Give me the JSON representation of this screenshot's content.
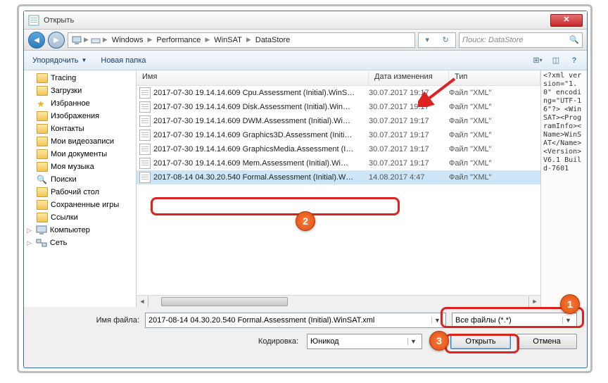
{
  "title": "Открыть",
  "close_glyph": "✕",
  "breadcrumb": [
    "Windows",
    "Performance",
    "WinSAT",
    "DataStore"
  ],
  "search_placeholder": "Поиск: DataStore",
  "toolbar": {
    "organize": "Упорядочить",
    "new_folder": "Новая папка"
  },
  "tree": {
    "items": [
      {
        "label": "Tracing",
        "icon": "folder",
        "lvl": 1
      },
      {
        "label": "Загрузки",
        "icon": "folder",
        "lvl": 1
      },
      {
        "label": "Избранное",
        "icon": "star",
        "lvl": 1
      },
      {
        "label": "Изображения",
        "icon": "image",
        "lvl": 1
      },
      {
        "label": "Контакты",
        "icon": "contact",
        "lvl": 1
      },
      {
        "label": "Мои видеозаписи",
        "icon": "video",
        "lvl": 1
      },
      {
        "label": "Мои документы",
        "icon": "doc",
        "lvl": 1
      },
      {
        "label": "Моя музыка",
        "icon": "music",
        "lvl": 1
      },
      {
        "label": "Поиски",
        "icon": "search",
        "lvl": 1
      },
      {
        "label": "Рабочий стол",
        "icon": "desktop",
        "lvl": 1
      },
      {
        "label": "Сохраненные игры",
        "icon": "games",
        "lvl": 1
      },
      {
        "label": "Ссылки",
        "icon": "link",
        "lvl": 1
      },
      {
        "label": "Компьютер",
        "icon": "computer",
        "lvl": 0
      },
      {
        "label": "Сеть",
        "icon": "network",
        "lvl": 0
      }
    ]
  },
  "columns": {
    "name": "Имя",
    "date": "Дата изменения",
    "type": "Тип"
  },
  "files": [
    {
      "name": "2017-07-30 19.14.14.609 Cpu.Assessment (Initial).WinS…",
      "date": "30.07.2017 19:17",
      "type": "Файл \"XML\""
    },
    {
      "name": "2017-07-30 19.14.14.609 Disk.Assessment (Initial).Win…",
      "date": "30.07.2017 19:17",
      "type": "Файл \"XML\""
    },
    {
      "name": "2017-07-30 19.14.14.609 DWM.Assessment (Initial).Wi…",
      "date": "30.07.2017 19:17",
      "type": "Файл \"XML\""
    },
    {
      "name": "2017-07-30 19.14.14.609 Graphics3D.Assessment (Initi…",
      "date": "30.07.2017 19:17",
      "type": "Файл \"XML\""
    },
    {
      "name": "2017-07-30 19.14.14.609 GraphicsMedia.Assessment (I…",
      "date": "30.07.2017 19:17",
      "type": "Файл \"XML\""
    },
    {
      "name": "2017-07-30 19.14.14.609 Mem.Assessment (Initial).Wi…",
      "date": "30.07.2017 19:17",
      "type": "Файл \"XML\""
    },
    {
      "name": "2017-08-14 04.30.20.540 Formal.Assessment (Initial).W…",
      "date": "14.08.2017 4:47",
      "type": "Файл \"XML\"",
      "selected": true
    }
  ],
  "preview_text": "<?xml version=\"1.0\" encoding=\"UTF-16\"?>\n<WinSAT><ProgramInfo><Name>WinSAT</Name><Version>V6.1 Build-7601",
  "filename_label": "Имя файла:",
  "filename_value": "2017-08-14 04.30.20.540 Formal.Assessment (Initial).WinSAT.xml",
  "filter_value": "Все файлы (*.*)",
  "encoding_label": "Кодировка:",
  "encoding_value": "Юникод",
  "open_btn": "Открыть",
  "cancel_btn": "Отмена",
  "anno": {
    "n1": "1",
    "n2": "2",
    "n3": "3"
  }
}
